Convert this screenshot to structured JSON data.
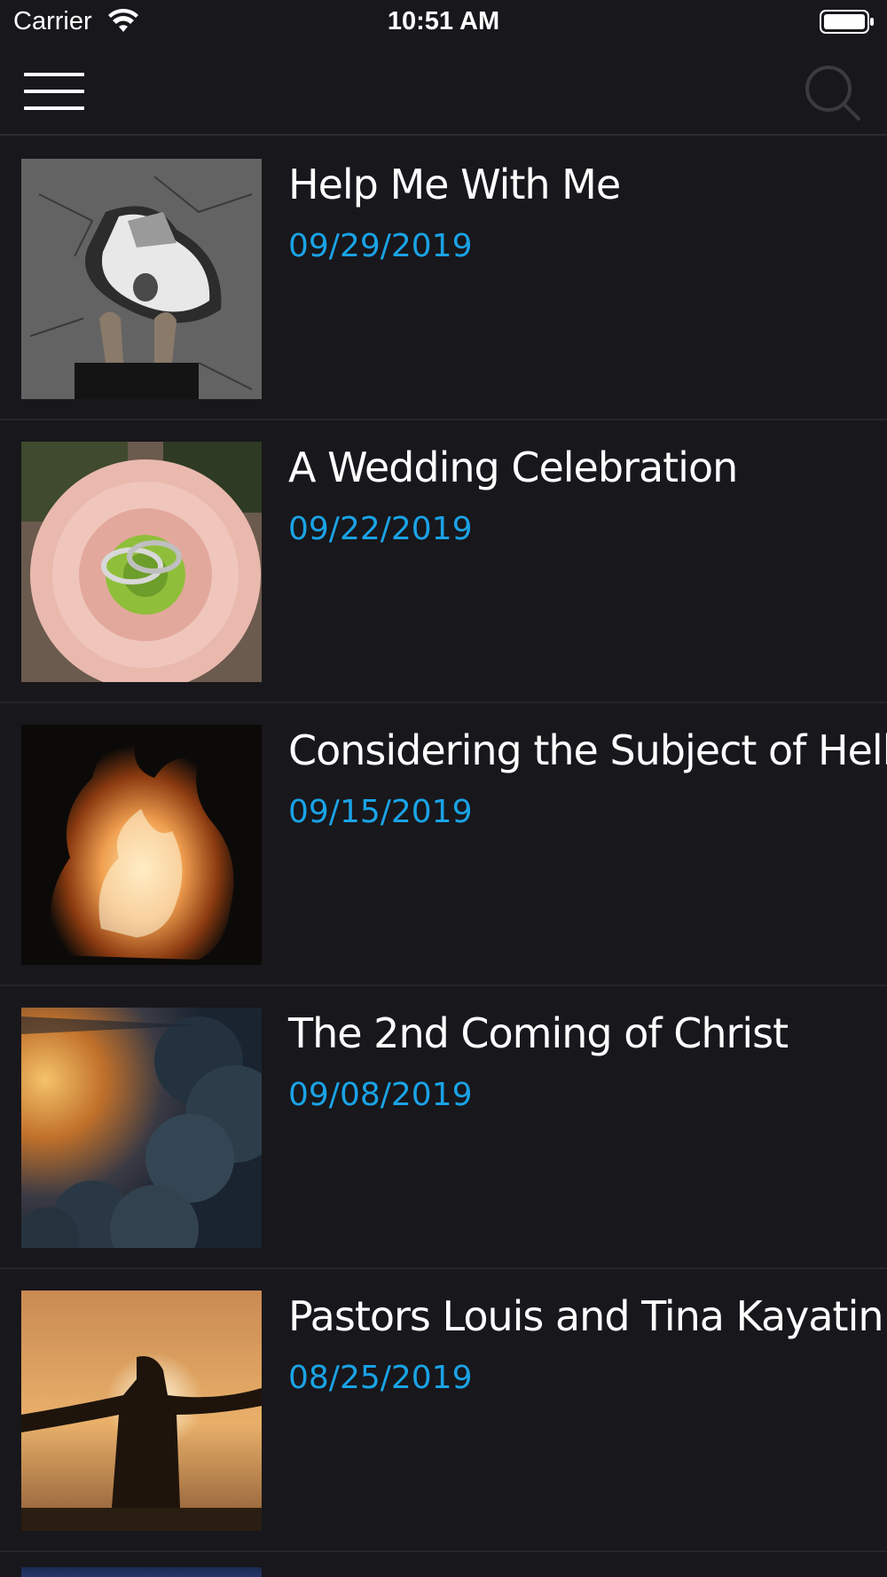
{
  "status_bar": {
    "carrier": "Carrier",
    "time": "10:51 AM"
  },
  "nav": {
    "menu_icon": "hamburger-menu-icon",
    "search_icon": "search-icon"
  },
  "colors": {
    "background": "#18171b",
    "accent_date": "#1aa3e6",
    "title_text": "#ffffff"
  },
  "sermons": [
    {
      "title": "Help Me With Me",
      "date": "09/29/2019",
      "thumbnail": "puddle-reflection-photo"
    },
    {
      "title": "A Wedding Celebration",
      "date": "09/22/2019",
      "thumbnail": "wedding-rings-flower-photo"
    },
    {
      "title": "Considering the Subject of Hell",
      "date": "09/15/2019",
      "thumbnail": "fire-flames-photo"
    },
    {
      "title": "The 2nd Coming of Christ",
      "date": "09/08/2019",
      "thumbnail": "sunlit-clouds-photo"
    },
    {
      "title": "Pastors Louis and Tina Kayatin",
      "date": "08/25/2019",
      "thumbnail": "man-sunset-silhouette-photo"
    }
  ]
}
